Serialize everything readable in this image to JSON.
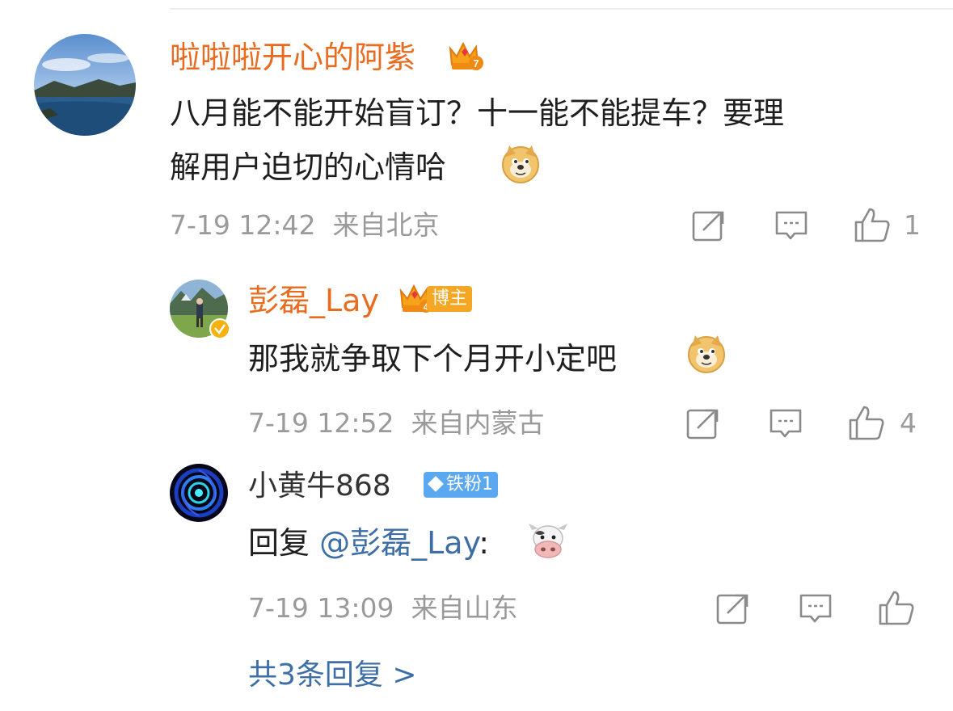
{
  "comment": {
    "username": "啦啦啦开心的阿紫",
    "text_line1": "八月能不能开始盲订？十一能不能提车？要理",
    "text_line2": "解用户迫切的心情哈",
    "time": "7-19 12:42",
    "location": "来自北京",
    "like_count": "1",
    "crown_level": "7"
  },
  "replies": [
    {
      "username": "彭磊_Lay",
      "crown_level": "4",
      "badge": "博主",
      "text": "那我就争取下个月开小定吧",
      "time": "7-19 12:52",
      "location": "来自内蒙古",
      "like_count": "4"
    },
    {
      "username": "小黄牛868",
      "badge": "铁粉1",
      "text_prefix": "回复",
      "mention": "@彭磊_Lay",
      "text_suffix": ":",
      "time": "7-19 13:09",
      "location": "来自山东"
    }
  ],
  "footer": {
    "more_replies": "共3条回复 >"
  },
  "colors": {
    "username_orange": "#e86b1f",
    "link_blue": "#3d6ea5",
    "meta_gray": "#9a9a9a",
    "badge_orange": "#f5a623",
    "badge_blue": "#5aa8f0"
  }
}
